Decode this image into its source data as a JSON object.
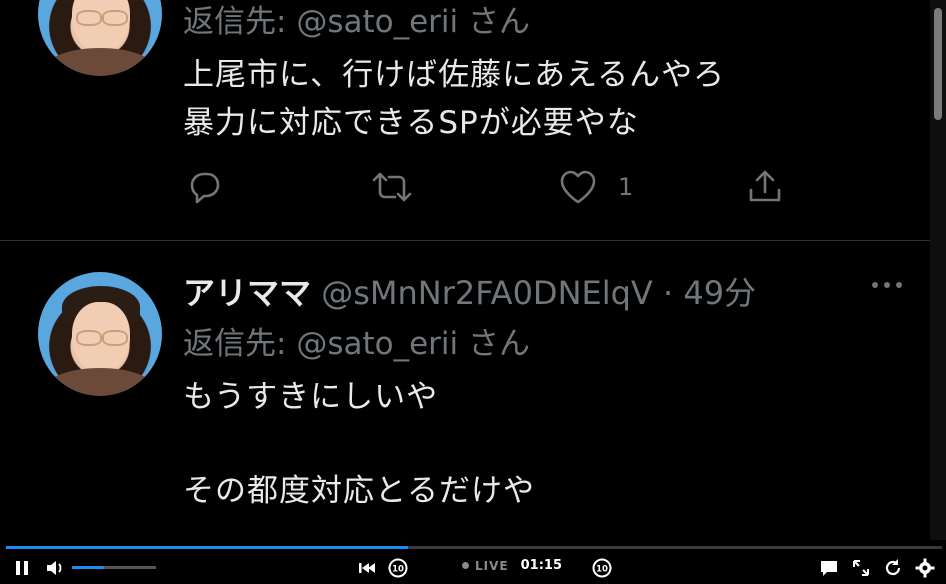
{
  "tweet1": {
    "reply_prefix": "返信先:",
    "reply_handle": "@sato_erii",
    "reply_suffix": "さん",
    "line1": "上尾市に、行けば佐藤にあえるんやろ",
    "line2": "暴力に対応できるSPが必要やな",
    "like_count": "1"
  },
  "tweet2": {
    "display_name": "アリママ",
    "handle": "@sMnNr2FA0DNElqV",
    "separator": "·",
    "time": "49分",
    "reply_prefix": "返信先:",
    "reply_handle": "@sato_erii",
    "reply_suffix": "さん",
    "line1": "もうすきにしいや",
    "line2": "その都度対応とるだけや"
  },
  "player": {
    "live_label": "LIVE",
    "timecode": "01:15",
    "progress_fraction": 0.43,
    "volume_fraction": 0.38,
    "accent_color": "#1d8cf0",
    "icons": [
      "pause-icon",
      "volume-icon",
      "skip-to-start-icon",
      "rewind-10-icon",
      "forward-10-icon",
      "captions-icon",
      "fullscreen-icon",
      "refresh-icon",
      "settings-icon"
    ]
  }
}
